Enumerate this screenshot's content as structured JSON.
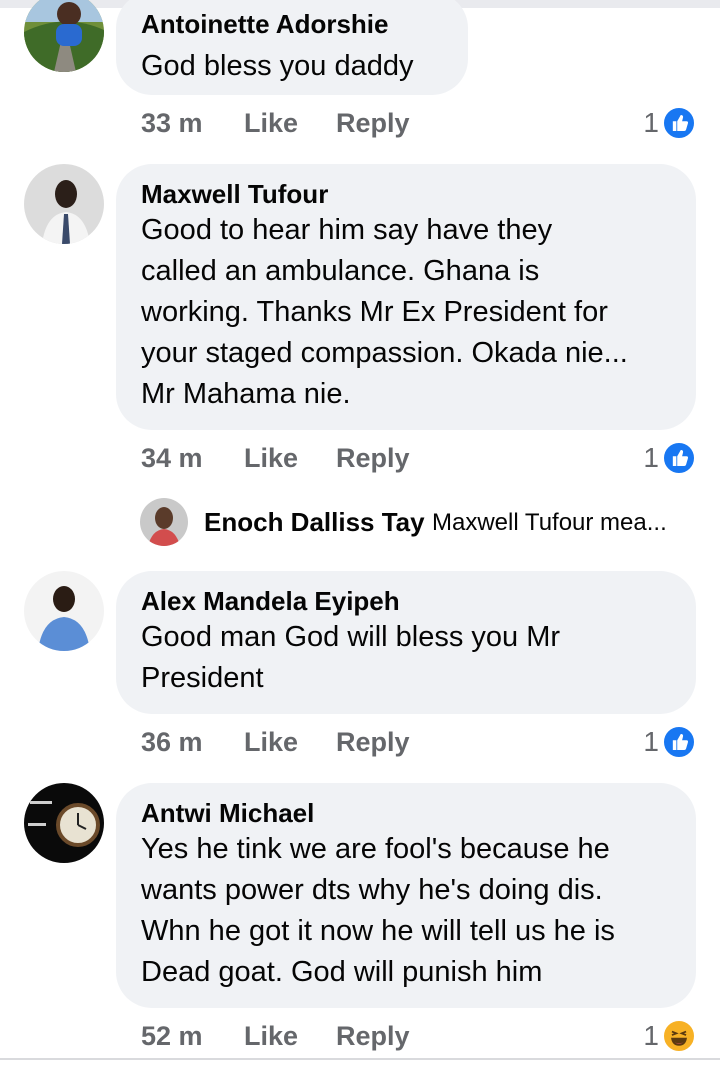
{
  "comments": [
    {
      "author": "Antoinette Adorshie",
      "text": "God bless you daddy",
      "time": "33 m",
      "like_label": "Like",
      "reply_label": "Reply",
      "reaction_count": "1",
      "reaction_icon": "like-reaction-icon"
    },
    {
      "author": "Maxwell Tufour",
      "text_lines": [
        "Good to hear him say have they",
        "called an ambulance. Ghana is",
        "working. Thanks Mr Ex President for",
        "your staged compassion. Okada nie...",
        "Mr Mahama nie."
      ],
      "time": "34 m",
      "like_label": "Like",
      "reply_label": "Reply",
      "reaction_count": "1",
      "reaction_icon": "like-reaction-icon"
    },
    {
      "author": "Alex Mandela Eyipeh",
      "text_lines": [
        "Good man God will bless you Mr",
        "President"
      ],
      "time": "36 m",
      "like_label": "Like",
      "reply_label": "Reply",
      "reaction_count": "1",
      "reaction_icon": "like-reaction-icon"
    },
    {
      "author": "Antwi Michael",
      "text_lines": [
        "Yes he tink we are fool's because he",
        "wants power dts why he's doing dis.",
        "Whn he got it now he will tell us he is",
        "Dead goat. God will punish him"
      ],
      "time": "52 m",
      "like_label": "Like",
      "reply_label": "Reply",
      "reaction_count": "1",
      "reaction_icon": "haha-reaction-icon"
    }
  ],
  "reply_preview": {
    "author": "Enoch Dalliss Tay",
    "text": "Maxwell Tufour mea..."
  },
  "colors": {
    "bubble": "#f0f2f5",
    "meta": "#65676b",
    "like_blue": "#1877f2",
    "haha_yellow": "#f7b125"
  }
}
